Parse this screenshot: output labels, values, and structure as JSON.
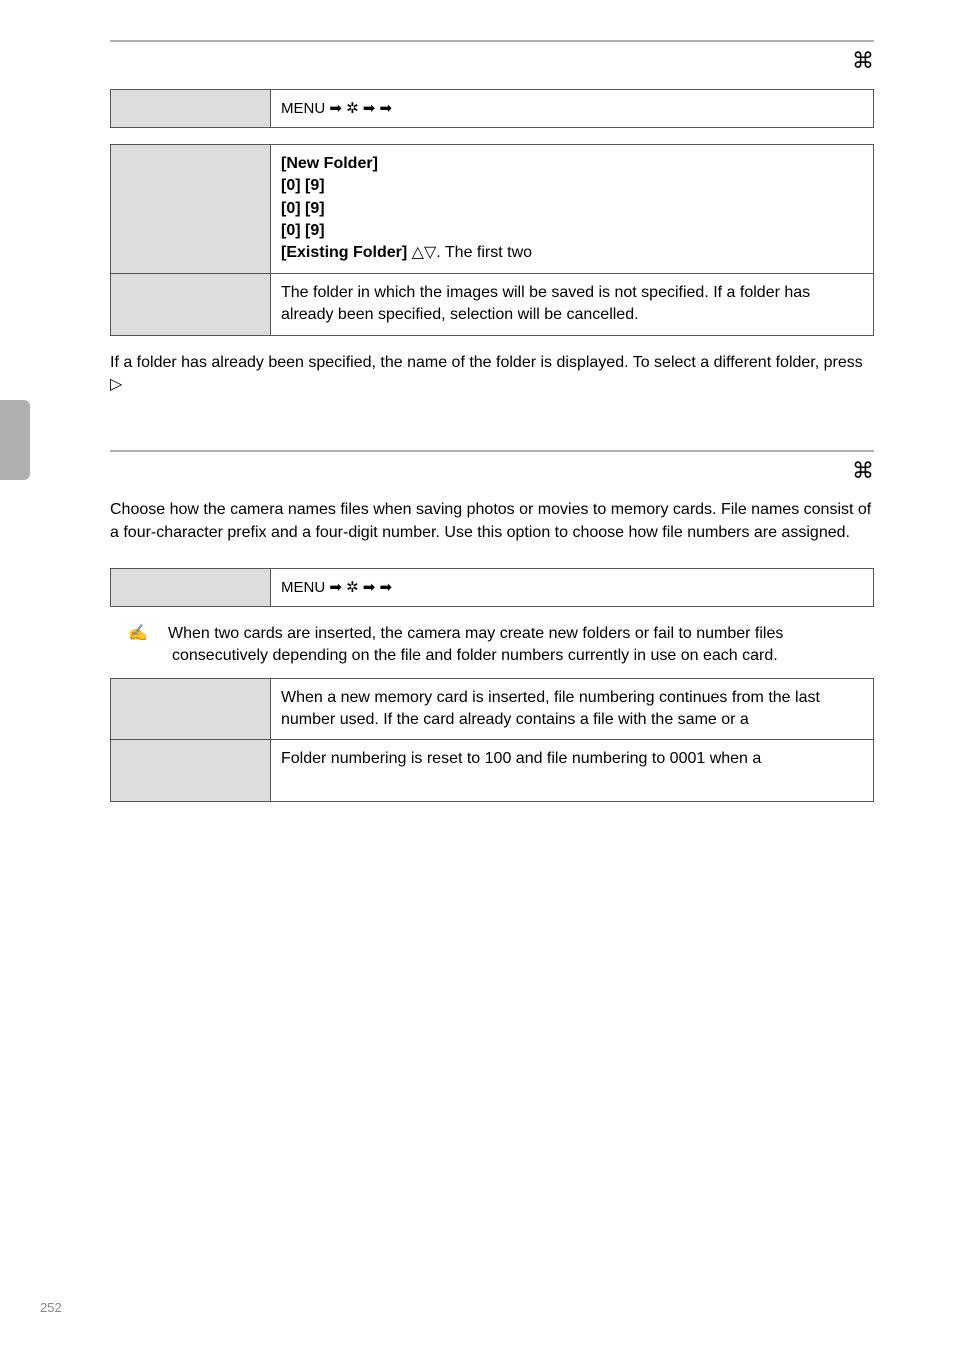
{
  "page_number": "252",
  "section1": {
    "icon": "⌘",
    "menu_cell": "MENU ➡ ✲ ➡                          ➡",
    "row1": {
      "label": "",
      "text_parts": {
        "new_folder": "[New Folder]",
        "pad1": "              ",
        "range1": "[0]   [9]",
        "pad2": "              ",
        "range2": "[0]   [9]",
        "pad3": "              ",
        "range3": "[0]   [9]",
        "existing_folder": "[Existing Folder]",
        "tail": "                                                   △▽. The first two"
      }
    },
    "row2": {
      "label": "",
      "text": "The folder in which the images will be saved is not specified. If a folder has already been specified, selection will be cancelled."
    },
    "after_para": "If a folder has already been specified, the name of the folder is displayed. To select a different folder, press ▷"
  },
  "section2": {
    "icon": "⌘",
    "intro": "Choose how the camera names files when saving photos or movies to memory cards. File names consist of a four-character prefix and a four-digit number. Use this option to choose how file numbers are assigned.",
    "menu_cell": "MENU ➡ ✲ ➡                          ➡",
    "tip": "When two cards are inserted, the camera may create new folders or fail to number files consecutively depending on the file and folder numbers currently in use on each card.",
    "row1": {
      "label": "",
      "text": "When a new memory card is inserted, file numbering continues from the last number used. If the card already contains a file with the same or a"
    },
    "row2": {
      "label": "",
      "text": "Folder numbering is reset to 100 and file numbering to 0001 when a"
    }
  }
}
